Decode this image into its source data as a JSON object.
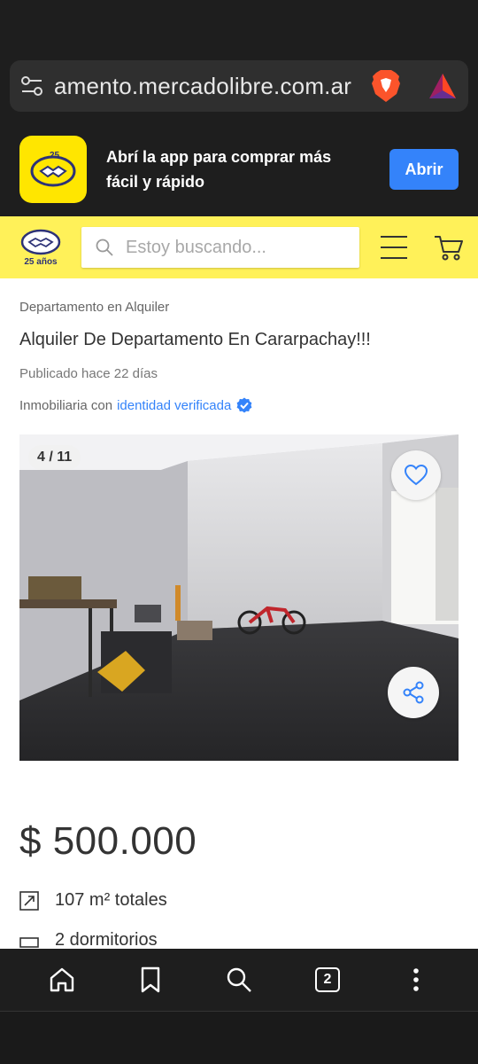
{
  "browser": {
    "url": "amento.mercadolibre.com.ar"
  },
  "app_banner": {
    "text": "Abrí la app para comprar más fácil y rápido",
    "button": "Abrir"
  },
  "header": {
    "logo_years": "25 años",
    "search_placeholder": "Estoy buscando..."
  },
  "listing": {
    "breadcrumb": "Departamento en Alquiler",
    "title": "Alquiler De Departamento En Cararpachay!!!",
    "published": "Publicado hace 22 días",
    "seller_prefix": "Inmobiliaria con",
    "seller_link": "identidad verificada",
    "photo_counter": "4 / 11",
    "price": "$ 500.000",
    "attributes": [
      {
        "label": "107 m² totales"
      },
      {
        "label": "2 dormitorios"
      }
    ]
  },
  "bottom_nav": {
    "tabs_count": "2"
  },
  "colors": {
    "ml_yellow": "#fff159",
    "accent_blue": "#3483fa"
  }
}
